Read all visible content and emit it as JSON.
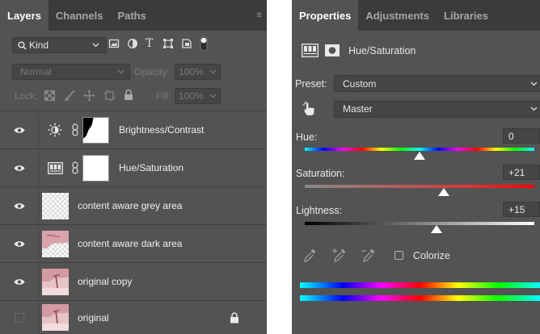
{
  "layers_panel": {
    "tabs": [
      {
        "label": "Layers",
        "active": true
      },
      {
        "label": "Channels",
        "active": false
      },
      {
        "label": "Paths",
        "active": false
      }
    ],
    "filter": {
      "label": "Kind"
    },
    "blend_mode": "Normal",
    "opacity_label": "Opacity:",
    "opacity_value": "100%",
    "lock_label": "Lock:",
    "fill_label": "Fill:",
    "fill_value": "100%",
    "layers": [
      {
        "name": "Brightness/Contrast",
        "type": "adjustment",
        "adj_icon": "brightness-icon",
        "visible": true
      },
      {
        "name": "Hue/Saturation",
        "type": "adjustment",
        "adj_icon": "hue-saturation-icon",
        "visible": true
      },
      {
        "name": "content aware grey area",
        "type": "pixel",
        "visible": true
      },
      {
        "name": "content aware dark area",
        "type": "pixel",
        "visible": true
      },
      {
        "name": "original copy",
        "type": "pixel",
        "visible": true
      },
      {
        "name": "original",
        "type": "pixel",
        "visible": false,
        "locked": true
      }
    ]
  },
  "properties_panel": {
    "tabs": [
      {
        "label": "Properties",
        "active": true
      },
      {
        "label": "Adjustments",
        "active": false
      },
      {
        "label": "Libraries",
        "active": false
      }
    ],
    "adjustment_title": "Hue/Saturation",
    "preset_label": "Preset:",
    "preset_value": "Custom",
    "channel_value": "Master",
    "hue": {
      "label": "Hue:",
      "value": "0",
      "fraction": 0.5
    },
    "saturation": {
      "label": "Saturation:",
      "value": "+21",
      "fraction": 0.605
    },
    "lightness": {
      "label": "Lightness:",
      "value": "+15",
      "fraction": 0.575
    },
    "colorize_label": "Colorize",
    "colorize_checked": false
  },
  "colors": {
    "panel_bg": "#535353",
    "tabbar_bg": "#3b3b3b"
  }
}
